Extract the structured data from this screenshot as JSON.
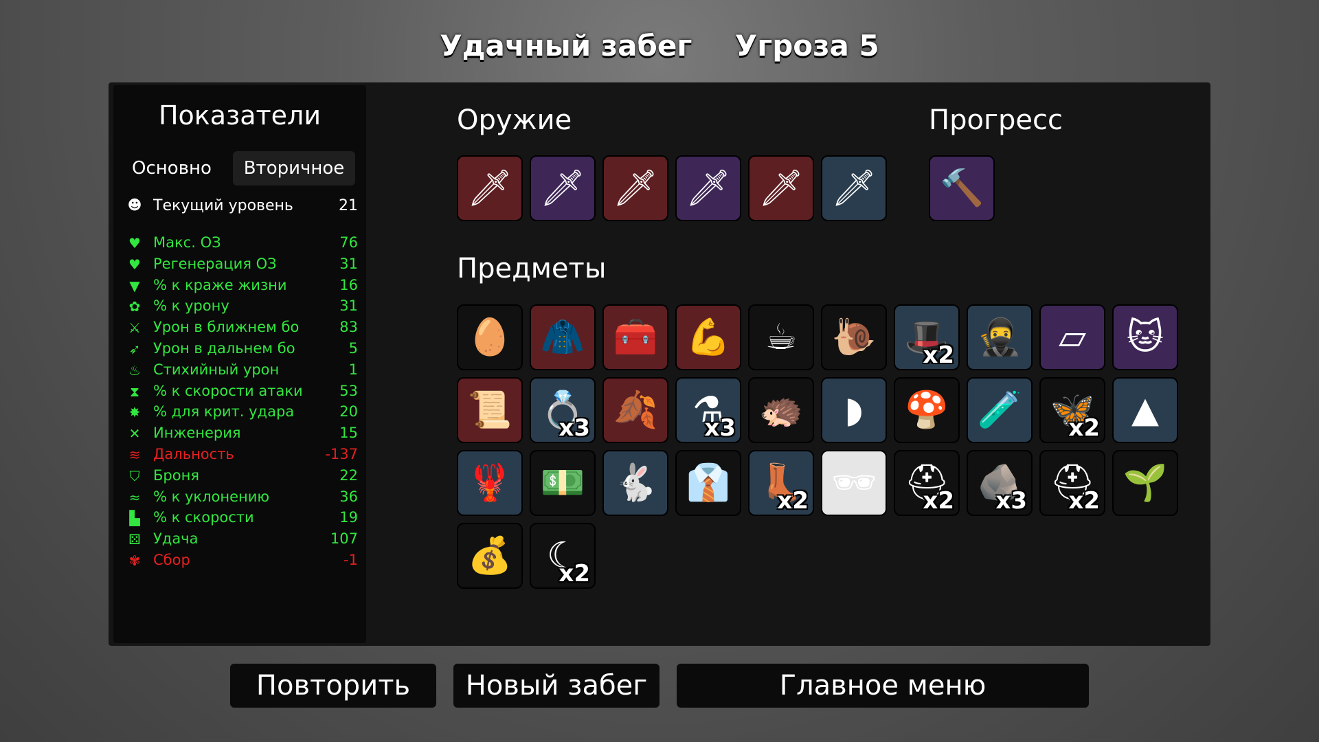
{
  "header": {
    "run_result": "Удачный забег",
    "danger": "Угроза 5"
  },
  "stats": {
    "title": "Показатели",
    "tabs": {
      "primary": "Основно",
      "secondary": "Вторичное"
    },
    "level": {
      "label": "Текущий уровень",
      "value": "21",
      "icon": "level-up-icon"
    },
    "rows": [
      {
        "label": "Макс. ОЗ",
        "value": "76",
        "color": "#33e640",
        "icon": "heart-icon"
      },
      {
        "label": "Регенерация ОЗ",
        "value": "31",
        "color": "#33e640",
        "icon": "heart-plus-icon"
      },
      {
        "label": "% к краже жизни",
        "value": "16",
        "color": "#33e640",
        "icon": "fangs-icon"
      },
      {
        "label": "% к урону",
        "value": "31",
        "color": "#33e640",
        "icon": "brain-icon"
      },
      {
        "label": "Урон в ближнем бо",
        "value": "83",
        "color": "#33e640",
        "icon": "sword-icon"
      },
      {
        "label": "Урон в дальнем бо",
        "value": "5",
        "color": "#33e640",
        "icon": "bow-icon"
      },
      {
        "label": "Стихийный урон",
        "value": "1",
        "color": "#33e640",
        "icon": "flame-icon"
      },
      {
        "label": "% к скорости атаки",
        "value": "53",
        "color": "#33e640",
        "icon": "hourglass-icon"
      },
      {
        "label": "% для крит. удара",
        "value": "20",
        "color": "#33e640",
        "icon": "crit-star-icon"
      },
      {
        "label": "Инженерия",
        "value": "15",
        "color": "#33e640",
        "icon": "wrench-cross-icon"
      },
      {
        "label": "Дальность",
        "value": "-137",
        "color": "#e52020",
        "icon": "range-waves-icon"
      },
      {
        "label": "Броня",
        "value": "22",
        "color": "#33e640",
        "icon": "shield-icon"
      },
      {
        "label": "% к уклонению",
        "value": "36",
        "color": "#33e640",
        "icon": "dodge-wind-icon"
      },
      {
        "label": "% к скорости",
        "value": "19",
        "color": "#33e640",
        "icon": "boot-icon"
      },
      {
        "label": "Удача",
        "value": "107",
        "color": "#33e640",
        "icon": "dice-icon"
      },
      {
        "label": "Сбор",
        "value": "-1",
        "color": "#e52020",
        "icon": "harvest-wheat-icon"
      }
    ]
  },
  "weapons": {
    "title": "Оружие",
    "slots": [
      {
        "icon": "sword-icon",
        "tier": "red"
      },
      {
        "icon": "sword-icon",
        "tier": "purple"
      },
      {
        "icon": "sword-icon",
        "tier": "red"
      },
      {
        "icon": "sword-icon",
        "tier": "purple"
      },
      {
        "icon": "sword-icon",
        "tier": "red"
      },
      {
        "icon": "sword-icon",
        "tier": "blue"
      }
    ]
  },
  "progress": {
    "title": "Прогресс",
    "slots": [
      {
        "icon": "hammer-icon",
        "tier": "purple"
      }
    ]
  },
  "items": {
    "title": "Предметы",
    "slots": [
      {
        "icon": "duck-egg-icon",
        "tier": "dark",
        "count": ""
      },
      {
        "icon": "red-hoodie-icon",
        "tier": "red",
        "count": ""
      },
      {
        "icon": "medkit-icon",
        "tier": "red",
        "count": ""
      },
      {
        "icon": "arm-icon",
        "tier": "red",
        "count": ""
      },
      {
        "icon": "coffee-cup-icon",
        "tier": "dark",
        "count": ""
      },
      {
        "icon": "snail-icon",
        "tier": "dark",
        "count": ""
      },
      {
        "icon": "beret-icon",
        "tier": "blue",
        "count": "x2"
      },
      {
        "icon": "ninja-icon",
        "tier": "blue",
        "count": ""
      },
      {
        "icon": "whetstone-icon",
        "tier": "purple",
        "count": ""
      },
      {
        "icon": "cat-icon",
        "tier": "purple",
        "count": ""
      },
      {
        "icon": "scroll-icon",
        "tier": "red",
        "count": ""
      },
      {
        "icon": "ring-icon",
        "tier": "blue",
        "count": "x3"
      },
      {
        "icon": "rainbow-leaf-icon",
        "tier": "red",
        "count": ""
      },
      {
        "icon": "potion-flask-icon",
        "tier": "blue",
        "count": "x3"
      },
      {
        "icon": "hedgehog-icon",
        "tier": "dark",
        "count": ""
      },
      {
        "icon": "blade-shard-icon",
        "tier": "blue",
        "count": ""
      },
      {
        "icon": "mushroom-icon",
        "tier": "dark",
        "count": ""
      },
      {
        "icon": "green-potion-icon",
        "tier": "blue",
        "count": ""
      },
      {
        "icon": "butterfly-icon",
        "tier": "dark",
        "count": "x2"
      },
      {
        "icon": "bullet-icon",
        "tier": "blue",
        "count": ""
      },
      {
        "icon": "claws-icon",
        "tier": "blue",
        "count": ""
      },
      {
        "icon": "banknote-icon",
        "tier": "dark",
        "count": ""
      },
      {
        "icon": "rabbit-icon",
        "tier": "blue",
        "count": ""
      },
      {
        "icon": "plaid-shirt-icon",
        "tier": "dark",
        "count": ""
      },
      {
        "icon": "boot-item-icon",
        "tier": "blue",
        "count": "x2"
      },
      {
        "icon": "glasses-icon",
        "tier": "white",
        "count": ""
      },
      {
        "icon": "helmet-dark-icon",
        "tier": "dark",
        "count": "x2"
      },
      {
        "icon": "stone-icon",
        "tier": "dark",
        "count": "x3"
      },
      {
        "icon": "knight-helmet-icon",
        "tier": "dark",
        "count": "x2"
      },
      {
        "icon": "sprout-icon",
        "tier": "dark",
        "count": ""
      },
      {
        "icon": "sack-icon",
        "tier": "dark",
        "count": ""
      },
      {
        "icon": "crescent-moon-icon",
        "tier": "dark",
        "count": "x2"
      }
    ]
  },
  "buttons": {
    "retry": "Повторить",
    "new_run": "Новый забег",
    "main_menu": "Главное меню"
  }
}
